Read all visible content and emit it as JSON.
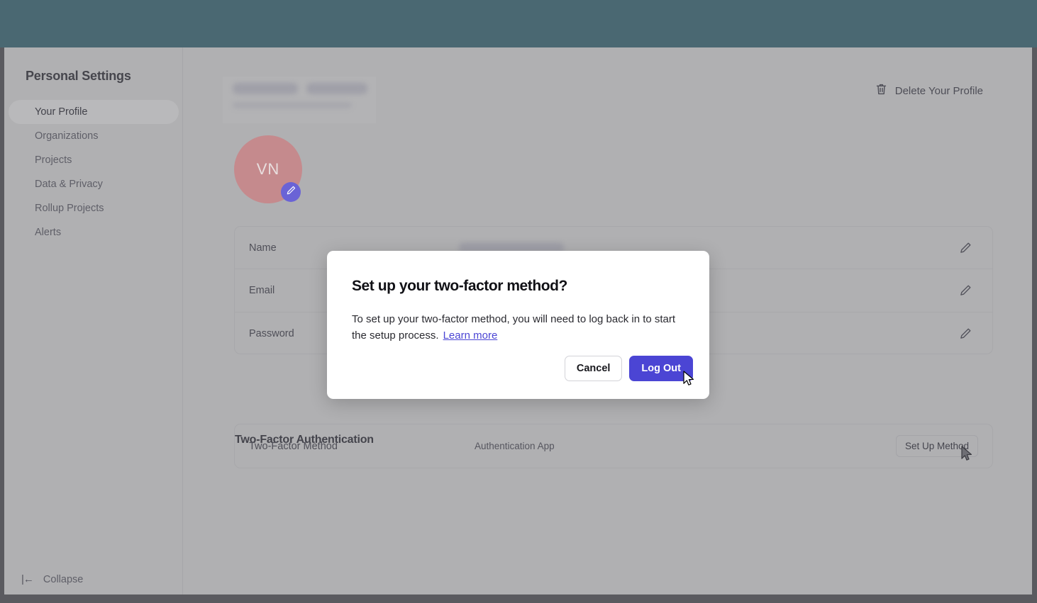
{
  "app": {
    "topbar_color": "#4a6872",
    "page_background": "#b0b0b2"
  },
  "sidebar": {
    "title": "Personal Settings",
    "items": [
      {
        "label": "Your Profile",
        "active": true
      },
      {
        "label": "Organizations",
        "active": false
      },
      {
        "label": "Projects",
        "active": false
      },
      {
        "label": "Data & Privacy",
        "active": false
      },
      {
        "label": "Rollup Projects",
        "active": false
      },
      {
        "label": "Alerts",
        "active": false
      }
    ],
    "collapse_label": "Collapse",
    "collapse_icon": "collapse-panel-icon"
  },
  "profile": {
    "name_redacted": true,
    "email_redacted": true,
    "avatar_initials": "VN",
    "avatar_color": "#c58a8d",
    "avatar_edit_icon": "pencil-icon",
    "avatar_edit_color": "#6a63d6",
    "delete_label": "Delete Your Profile",
    "delete_icon": "trash-icon"
  },
  "info_rows": [
    {
      "label": "Name",
      "value_redacted": true,
      "edit_icon": "pencil-icon"
    },
    {
      "label": "Email",
      "value_redacted": true,
      "edit_icon": "pencil-icon"
    },
    {
      "label": "Password",
      "value_redacted": true,
      "edit_icon": "pencil-icon"
    }
  ],
  "two_factor": {
    "section_title": "Two-Factor Authentication",
    "row_label": "Two-Factor Method",
    "row_value": "Authentication App",
    "action_label": "Set Up Method"
  },
  "modal": {
    "title": "Set up your two-factor method?",
    "body_text": "To set up your two-factor method, you will need to log back in to start the setup process.",
    "link_label": "Learn more",
    "link_color": "#4b45d4",
    "cancel_label": "Cancel",
    "primary_label": "Log Out",
    "primary_color": "#4b45d4"
  }
}
